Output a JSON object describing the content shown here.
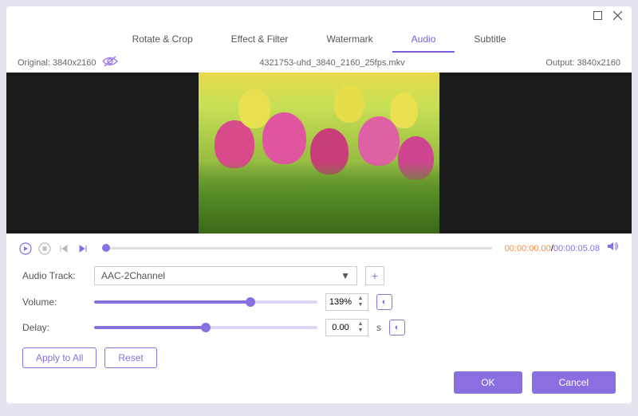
{
  "tabs": [
    "Rotate & Crop",
    "Effect & Filter",
    "Watermark",
    "Audio",
    "Subtitle"
  ],
  "active_tab": 3,
  "original_label": "Original: 3840x2160",
  "filename": "4321753-uhd_3840_2160_25fps.mkv",
  "output_label": "Output: 3840x2160",
  "time": {
    "current": "00:00:00.00",
    "duration": "00:00:05.08"
  },
  "form": {
    "audio_track_label": "Audio Track:",
    "audio_track_value": "AAC-2Channel",
    "volume_label": "Volume:",
    "volume_value": "139%",
    "volume_pct": 70,
    "delay_label": "Delay:",
    "delay_value": "0.00",
    "delay_unit": "s",
    "delay_pct": 50
  },
  "buttons": {
    "apply_all": "Apply to All",
    "reset": "Reset",
    "ok": "OK",
    "cancel": "Cancel"
  }
}
